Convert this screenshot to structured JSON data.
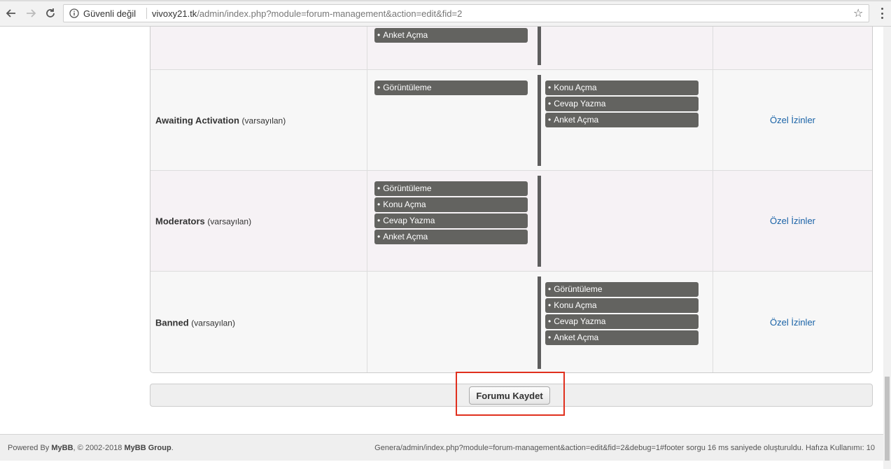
{
  "browser": {
    "security_label": "Güvenli değil",
    "url_host": "vivoxy21.tk",
    "url_path": "/admin/index.php?module=forum-management&action=edit&fid=2"
  },
  "permissions": {
    "rows": [
      {
        "group": "",
        "default_label": "",
        "left_perms": [
          "Anket Açma"
        ],
        "right_perms": [],
        "custom_link": ""
      },
      {
        "group": "Awaiting Activation",
        "default_label": "(varsayılan)",
        "left_perms": [
          "Görüntüleme"
        ],
        "right_perms": [
          "Konu Açma",
          "Cevap Yazma",
          "Anket Açma"
        ],
        "custom_link": "Özel İzinler"
      },
      {
        "group": "Moderators",
        "default_label": "(varsayılan)",
        "left_perms": [
          "Görüntüleme",
          "Konu Açma",
          "Cevap Yazma",
          "Anket Açma"
        ],
        "right_perms": [],
        "custom_link": "Özel İzinler"
      },
      {
        "group": "Banned",
        "default_label": "(varsayılan)",
        "left_perms": [],
        "right_perms": [
          "Görüntüleme",
          "Konu Açma",
          "Cevap Yazma",
          "Anket Açma"
        ],
        "custom_link": "Özel İzinler"
      }
    ]
  },
  "form": {
    "submit_label": "Forumu Kaydet"
  },
  "footer": {
    "powered_prefix": "Powered By ",
    "powered_brand": "MyBB",
    "copyright_mid": ", © 2002-2018 ",
    "copyright_brand": "MyBB Group",
    "copyright_end": ".",
    "debug_text": "Genera/admin/index.php?module=forum-management&action=edit&fid=2&debug=1#footer sorgu 16 ms saniyede oluşturuldu. Hafıza Kullanımı: 10"
  },
  "colors": {
    "link": "#1a63a7",
    "perm_item_bg": "#636360",
    "highlight": "#e0301e"
  }
}
